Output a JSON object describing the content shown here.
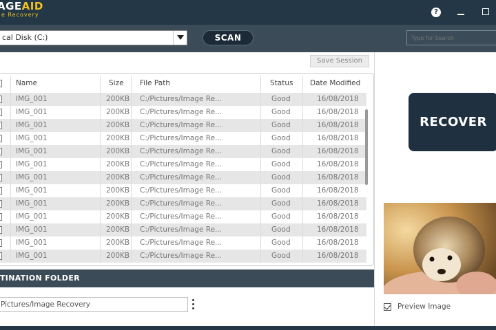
{
  "app": {
    "logo_line1_a": "AGE",
    "logo_line1_b": "AID",
    "logo_line2": "e Recovery",
    "help_icon_glyph": "?"
  },
  "toolbar": {
    "disk_value": "cal Disk (C:)",
    "scan_label": "SCAN",
    "search_placeholder": "Type for Search"
  },
  "save_session_label": "Save Session",
  "table": {
    "headers": {
      "name": "Name",
      "size": "Size",
      "path": "File Path",
      "status": "Status",
      "date": "Date Modified"
    },
    "rows": [
      {
        "name": "IMG_001",
        "size": "200KB",
        "path": "C:/Pictures/Image Re...",
        "status": "Good",
        "date": "16/08/2018"
      },
      {
        "name": "IMG_001",
        "size": "200KB",
        "path": "C:/Pictures/Image Re...",
        "status": "Good",
        "date": "16/08/2018"
      },
      {
        "name": "IMG_001",
        "size": "200KB",
        "path": "C:/Pictures/Image Re...",
        "status": "Good",
        "date": "16/08/2018"
      },
      {
        "name": "IMG_001",
        "size": "200KB",
        "path": "C:/Pictures/Image Re...",
        "status": "Good",
        "date": "16/08/2018"
      },
      {
        "name": "IMG_001",
        "size": "200KB",
        "path": "C:/Pictures/Image Re...",
        "status": "Good",
        "date": "16/08/2018"
      },
      {
        "name": "IMG_001",
        "size": "200KB",
        "path": "C:/Pictures/Image Re...",
        "status": "Good",
        "date": "16/08/2018"
      },
      {
        "name": "IMG_001",
        "size": "200KB",
        "path": "C:/Pictures/Image Re...",
        "status": "Good",
        "date": "16/08/2018"
      },
      {
        "name": "IMG_001",
        "size": "200KB",
        "path": "C:/Pictures/Image Re...",
        "status": "Good",
        "date": "16/08/2018"
      },
      {
        "name": "IMG_001",
        "size": "200KB",
        "path": "C:/Pictures/Image Re...",
        "status": "Good",
        "date": "16/08/2018"
      },
      {
        "name": "IMG_001",
        "size": "200KB",
        "path": "C:/Pictures/Image Re...",
        "status": "Good",
        "date": "16/08/2018"
      },
      {
        "name": "IMG_001",
        "size": "200KB",
        "path": "C:/Pictures/Image Re...",
        "status": "Good",
        "date": "16/08/2018"
      },
      {
        "name": "IMG_001",
        "size": "200KB",
        "path": "C:/Pictures/Image Re...",
        "status": "Good",
        "date": "16/08/2018"
      },
      {
        "name": "IMG_001",
        "size": "200KB",
        "path": "C:/Pictures/Image Re...",
        "status": "Good",
        "date": "16/08/2018"
      }
    ]
  },
  "destination": {
    "header": "TINATION FOLDER",
    "path_value": "Pictures/Image Recovery"
  },
  "recover_label": "RECOVER",
  "preview_label": "Preview Image",
  "colors": {
    "titlebar": "#243746",
    "toolbar": "#3b4b57",
    "accent_logo": "#f2c21a",
    "recover_button": "#1f3140"
  }
}
